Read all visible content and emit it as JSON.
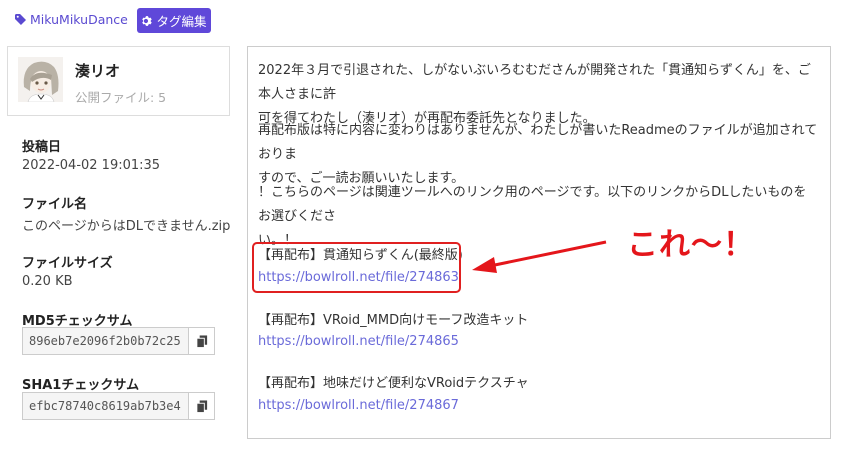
{
  "tag": {
    "name": "MikuMikuDance",
    "edit_label": "タグ編集"
  },
  "author": {
    "name": "湊リオ",
    "public_files": "公開ファイル: 5"
  },
  "meta": {
    "posted_label": "投稿日",
    "posted_value": "2022-04-02 19:01:35",
    "filename_label": "ファイル名",
    "filename_value": "このページからはDLできません.zip",
    "filesize_label": "ファイルサイズ",
    "filesize_value": "0.20 KB",
    "md5_label": "MD5チェックサム",
    "md5_value": "896eb7e2096f2b0b72c25",
    "sha1_label": "SHA1チェックサム",
    "sha1_value": "efbc78740c8619ab7b3e4"
  },
  "description": {
    "p1_line1": "2022年３月で引退された、しがないぶいろむむださんが開発された「貫通知らずくん」を、ご本人さまに許",
    "p1_line2": "可を得てわたし（湊リオ）が再配布委託先となりました。",
    "p2_line1": "再配布版は特に内容に変わりはありませんが、わたしが書いたReadmeのファイルが追加されておりま",
    "p2_line2": "すので、ご一読お願いいたします。",
    "p3_line1": "！こちらのページは関連ツールへのリンク用のページです。以下のリンクからDLしたいものをお選びくださ",
    "p3_line2": "い。！",
    "items": [
      {
        "title": "【再配布】貫通知らずくん(最終版)",
        "url": "https://bowlroll.net/file/274863"
      },
      {
        "title": "【再配布】VRoid_MMD向けモーフ改造キット",
        "url": "https://bowlroll.net/file/274865"
      },
      {
        "title": "【再配布】地味だけど便利なVRoidテクスチャ",
        "url": "https://bowlroll.net/file/274867"
      }
    ]
  },
  "annotation": {
    "text": "これ～！"
  },
  "colors": {
    "accent": "#5f48d9",
    "link": "#6a6ad9",
    "annotation": "#e4161b"
  },
  "icons": {
    "tag": "tag-icon",
    "edit": "gear-icon",
    "copy": "copy-icon"
  }
}
